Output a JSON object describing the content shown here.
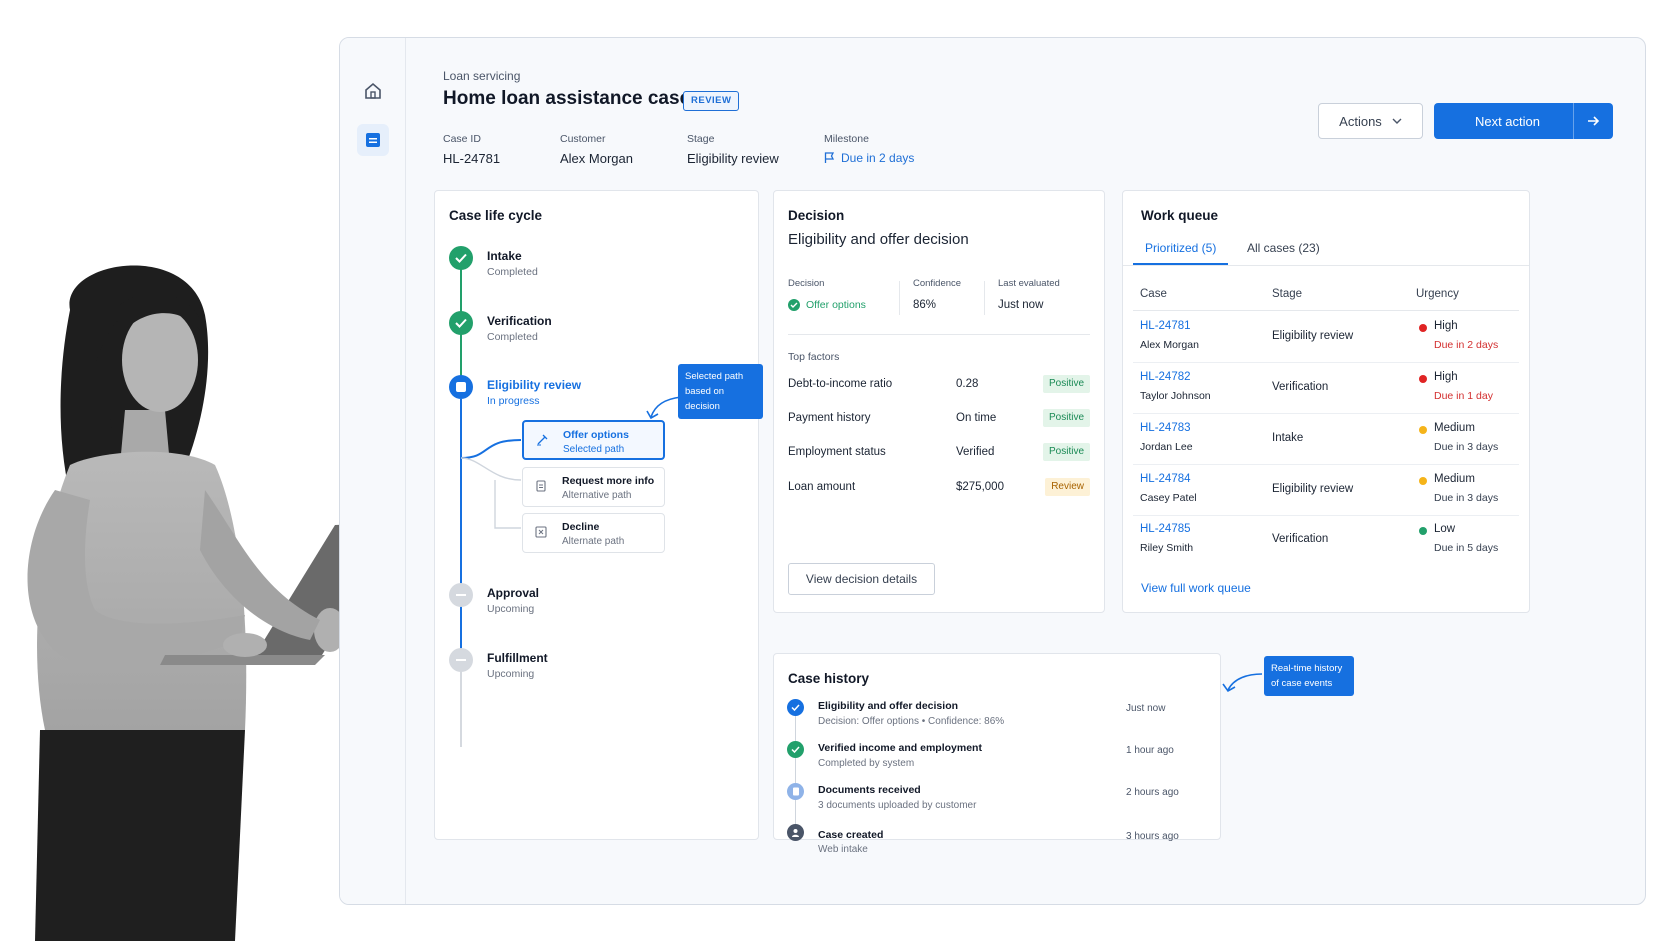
{
  "nav": {
    "home_icon": "home-icon",
    "cases_icon": "document-list-icon"
  },
  "header": {
    "eyebrow": "Loan servicing",
    "title": "Home loan assistance case",
    "badge": "REVIEW",
    "meta": [
      {
        "label": "Case ID",
        "value": "HL-24781"
      },
      {
        "label": "Customer",
        "value": "Alex Morgan"
      },
      {
        "label": "Stage",
        "value": "Eligibility review"
      },
      {
        "label": "Milestone",
        "value": "Due in 2 days"
      }
    ],
    "actions_label": "Actions",
    "next_label": "Next action"
  },
  "lifecycle": {
    "title": "Case life cycle",
    "steps": [
      {
        "name": "Intake",
        "status": "Completed"
      },
      {
        "name": "Verification",
        "status": "Completed"
      },
      {
        "name": "Eligibility review",
        "status": "In progress"
      },
      {
        "name": "Approval",
        "status": "Upcoming"
      },
      {
        "name": "Fulfillment",
        "status": "Upcoming"
      }
    ],
    "paths": [
      {
        "name": "Offer options",
        "sub": "Selected path"
      },
      {
        "name": "Request more info",
        "sub": "Alternative path"
      },
      {
        "name": "Decline",
        "sub": "Alternate path"
      }
    ],
    "callout_line1": "Selected path",
    "callout_line2": "based on decision"
  },
  "decision": {
    "title": "Decision",
    "subtitle": "Eligibility and offer decision",
    "decision_label": "Decision",
    "decision_value": "Offer options",
    "confidence_label": "Confidence",
    "confidence_value": "86%",
    "evaluated_label": "Last evaluated",
    "evaluated_value": "Just now",
    "factors_label": "Top factors",
    "factors": [
      {
        "name": "Debt-to-income ratio",
        "value": "0.28",
        "tag": "Positive"
      },
      {
        "name": "Payment history",
        "value": "On time",
        "tag": "Positive"
      },
      {
        "name": "Employment status",
        "value": "Verified",
        "tag": "Positive"
      },
      {
        "name": "Loan amount",
        "value": "$275,000",
        "tag": "Review"
      }
    ],
    "details_label": "View decision details"
  },
  "queue": {
    "title": "Work queue",
    "tab_prioritized": "Prioritized (5)",
    "tab_all": "All cases (23)",
    "col_case": "Case",
    "col_stage": "Stage",
    "col_urgency": "Urgency",
    "rows": [
      {
        "id": "HL-24781",
        "name": "Alex Morgan",
        "stage": "Eligibility review",
        "urgency": "High",
        "due": "Due in 2 days",
        "color": "#e02424"
      },
      {
        "id": "HL-24782",
        "name": "Taylor Johnson",
        "stage": "Verification",
        "urgency": "High",
        "due": "Due in 1 day",
        "color": "#e02424"
      },
      {
        "id": "HL-24783",
        "name": "Jordan Lee",
        "stage": "Intake",
        "urgency": "Medium",
        "due": "Due in 3 days",
        "color": "#f5b41a"
      },
      {
        "id": "HL-24784",
        "name": "Casey Patel",
        "stage": "Eligibility review",
        "urgency": "Medium",
        "due": "Due in 3 days",
        "color": "#f5b41a"
      },
      {
        "id": "HL-24785",
        "name": "Riley Smith",
        "stage": "Verification",
        "urgency": "Low",
        "due": "Due in 5 days",
        "color": "#22a06b"
      }
    ],
    "link": "View full work queue"
  },
  "history": {
    "title": "Case history",
    "events": [
      {
        "title": "Eligibility and offer decision",
        "detail": "Decision: Offer options • Confidence: 86%",
        "when": "Just now"
      },
      {
        "title": "Verified income and employment",
        "detail": "Completed by system",
        "when": "1 hour ago"
      },
      {
        "title": "Documents received",
        "detail": "3 documents uploaded by customer",
        "when": "2 hours ago"
      },
      {
        "title": "Case created",
        "detail": "Web intake",
        "when": "3 hours ago"
      }
    ],
    "callout_line1": "Real-time history",
    "callout_line2": "of case events"
  },
  "colors": {
    "accent": "#1670e0",
    "success": "#22a06b",
    "danger": "#e02424",
    "warning": "#f5b41a"
  }
}
